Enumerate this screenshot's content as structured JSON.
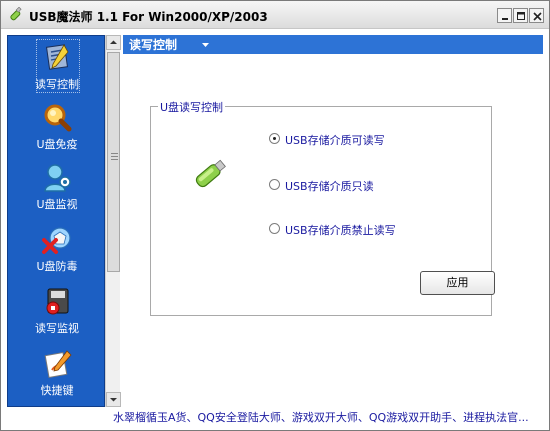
{
  "window": {
    "title": "USB魔法师 1.1 For Win2000/XP/2003"
  },
  "sidebar": {
    "items": [
      {
        "label": "读写控制",
        "icon": "readwrite-control-icon",
        "active": true
      },
      {
        "label": "U盘免疫",
        "icon": "magnifier-icon",
        "active": false
      },
      {
        "label": "U盘监视",
        "icon": "monitor-person-icon",
        "active": false
      },
      {
        "label": "U盘防毒",
        "icon": "antivirus-icon",
        "active": false
      },
      {
        "label": "读写监视",
        "icon": "disk-monitor-icon",
        "active": false
      },
      {
        "label": "快捷键",
        "icon": "shortcut-pen-icon",
        "active": false
      }
    ]
  },
  "section": {
    "title": "读写控制"
  },
  "group": {
    "legend": "U盘读写控制"
  },
  "options": [
    {
      "label": "USB存储介质可读写",
      "checked": true
    },
    {
      "label": "USB存储介质只读",
      "checked": false
    },
    {
      "label": "USB存储介质禁止读写",
      "checked": false
    }
  ],
  "apply_label": "应用",
  "footer_marquee": "水翠榴循玉A货、QQ安全登陆大师、游戏双开大师、QQ游戏双开助手、进程执法官...",
  "colors": {
    "sidebar": "#1c5fc3",
    "header": "#2d73d6",
    "link_text": "#1a1aa0"
  }
}
